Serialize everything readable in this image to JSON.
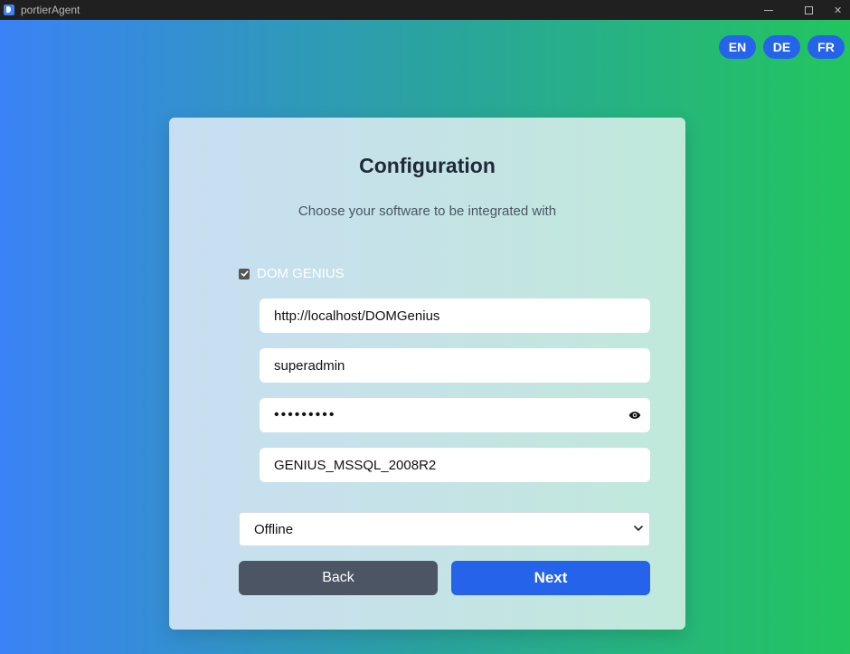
{
  "window": {
    "title": "portierAgent",
    "close_glyph": "✕"
  },
  "languages": [
    "EN",
    "DE",
    "FR"
  ],
  "card": {
    "title": "Configuration",
    "subtitle": "Choose your software to be integrated with"
  },
  "integration": {
    "checked": true,
    "label": "DOM GENIUS",
    "fields": {
      "url": "http://localhost/DOMGenius",
      "username": "superadmin",
      "password_masked": "•••••••••",
      "database": "GENIUS_MSSQL_2008R2"
    }
  },
  "mode_select": {
    "selected": "Offline"
  },
  "buttons": {
    "back": "Back",
    "next": "Next"
  },
  "colors": {
    "accent": "#2563eb",
    "back_button": "#4b5563",
    "gradient_start": "#3b82f6",
    "gradient_end": "#22c55e"
  }
}
